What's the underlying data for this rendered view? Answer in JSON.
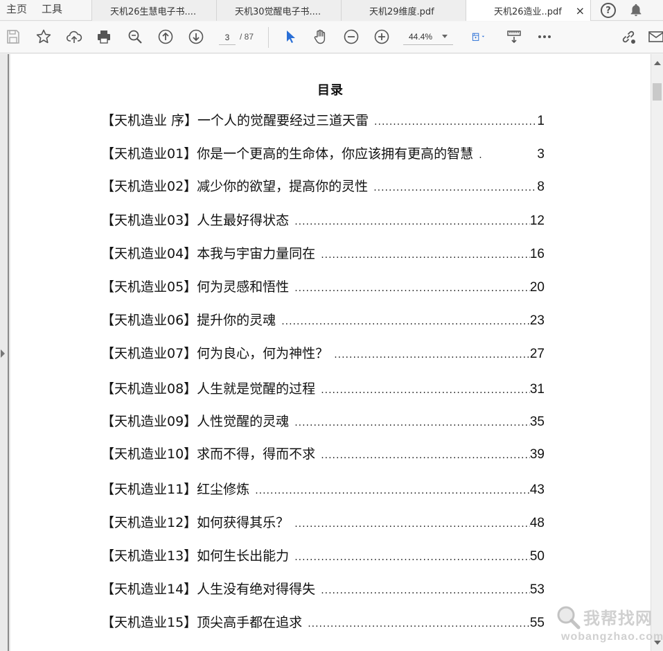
{
  "nav": {
    "home_label": "主页",
    "tools_label": "工具"
  },
  "tabs": [
    {
      "label": "天机26生慧电子书...."
    },
    {
      "label": "天机30觉醒电子书...."
    },
    {
      "label": "天机29维度.pdf"
    },
    {
      "label": "天机26造业..pdf",
      "active": true
    }
  ],
  "tab_close_glyph": "×",
  "help_glyph": "?",
  "toolbar": {
    "current_page": "3",
    "total_pages": "/ 87",
    "zoom": "44.4%"
  },
  "document": {
    "toc_title": "目录",
    "entries": [
      {
        "label": "【天机造业 序】一个人的觉醒要经过三道天雷",
        "dots": "..................................................................................",
        "page": "1"
      },
      {
        "label": "【天机造业01】你是一个更高的生命体，你应该拥有更高的智慧",
        "dots": ".",
        "page": "3"
      },
      {
        "label": "【天机造业02】减少你的欲望，提高你的灵性",
        "dots": "..................................................................................",
        "page": "8"
      },
      {
        "label": "【天机造业03】人生最好得状态",
        "dots": "..................................................................................................................",
        "page": "12"
      },
      {
        "label": "【天机造业04】本我与宇宙力量同在",
        "dots": "..................................................................................................................",
        "page": "16"
      },
      {
        "label": "【天机造业05】何为灵感和悟性",
        "dots": "..................................................................................................................",
        "page": "20"
      },
      {
        "label": "【天机造业06】提升你的灵魂",
        "dots": "..................................................................................................................",
        "page": "23"
      },
      {
        "label": "【天机造业07】何为良心，何为神性？",
        "dots": "..................................................................................................................",
        "page": "27"
      },
      {
        "label": "【天机造业08】人生就是觉醒的过程",
        "dots": "..................................................................................................................",
        "page": "31"
      },
      {
        "label": "【天机造业09】人性觉醒的灵魂",
        "dots": "..................................................................................................................",
        "page": "35"
      },
      {
        "label": "【天机造业10】求而不得，得而不求",
        "dots": "..................................................................................................................",
        "page": "39"
      },
      {
        "label": "【天机造业11】红尘修炼",
        "dots": "..................................................................................................................",
        "page": "43"
      },
      {
        "label": "【天机造业12】如何获得其乐？",
        "dots": "..................................................................................................................",
        "page": "48"
      },
      {
        "label": "【天机造业13】如何生长出能力",
        "dots": "..................................................................................................................",
        "page": "50"
      },
      {
        "label": "【天机造业14】人生没有绝对得得失",
        "dots": "..................................................................................................................",
        "page": "53"
      },
      {
        "label": "【天机造业15】顶尖高手都在追求",
        "dots": "..................................................................................................................",
        "page": "55"
      }
    ]
  },
  "watermark": {
    "cn": "我帮找网",
    "url": "wobangzhao.com"
  },
  "colors": {
    "accent": "#2a6fd6",
    "page_bg": "#ffffff",
    "viewer_bg": "#e8e8e8"
  }
}
